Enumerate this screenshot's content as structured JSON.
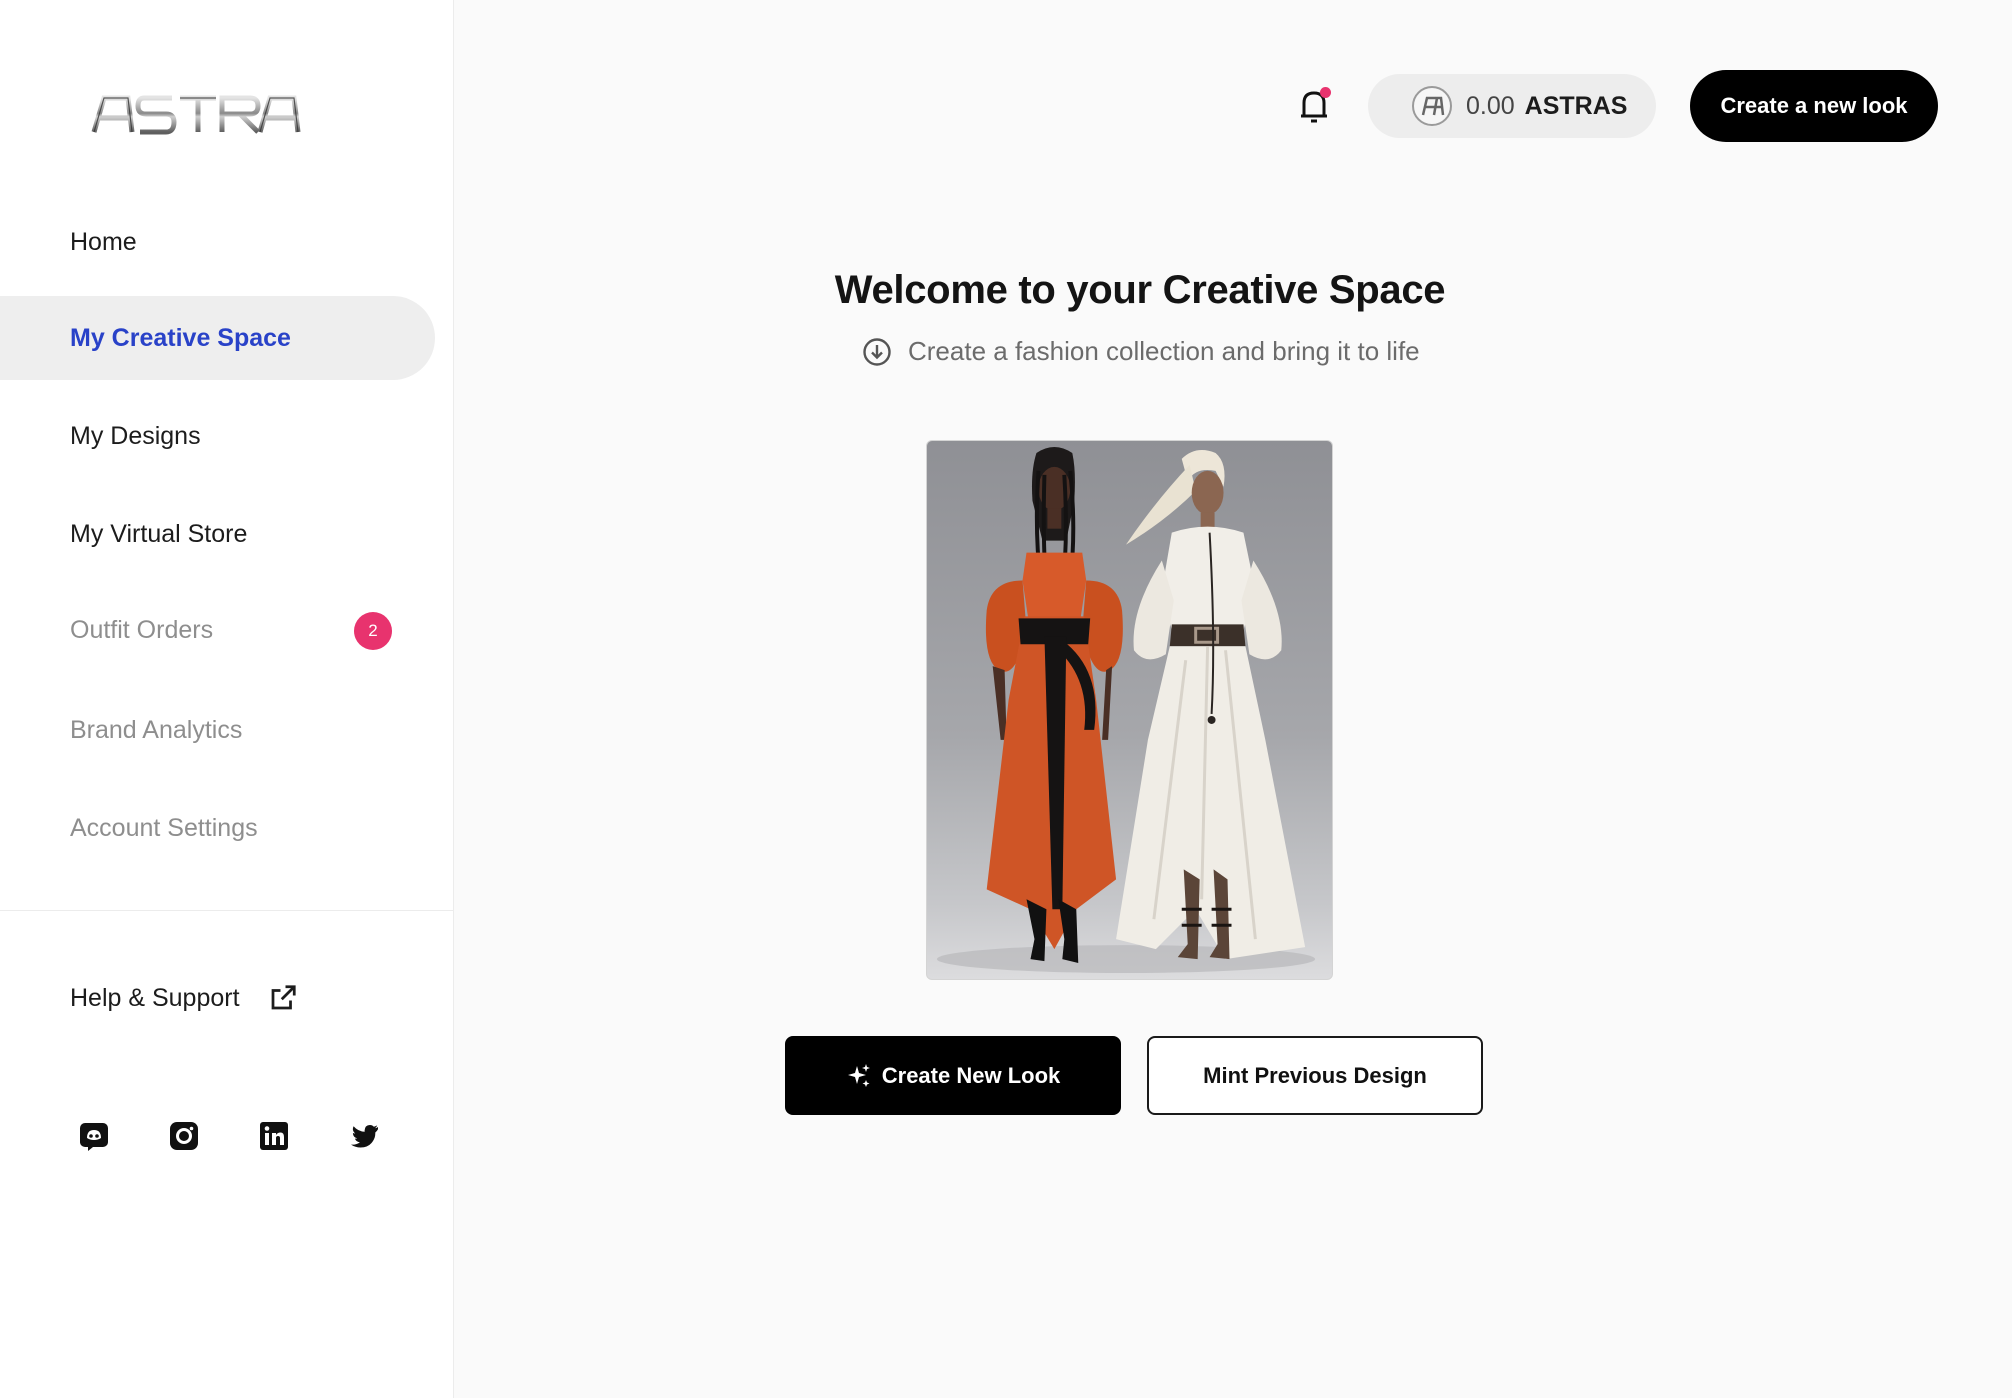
{
  "brand": {
    "logo_text": "ASTRA"
  },
  "sidebar": {
    "nav": [
      {
        "label": "Home"
      },
      {
        "label": "My Creative Space",
        "active": true
      },
      {
        "label": "My Designs"
      },
      {
        "label": "My Virtual Store"
      },
      {
        "label": "Outfit Orders",
        "badge": "2",
        "disabled": true
      },
      {
        "label": "Brand Analytics",
        "disabled": true
      },
      {
        "label": "Account Settings",
        "disabled": true
      }
    ],
    "help": {
      "label": "Help & Support",
      "icon": "external-link-icon"
    },
    "socials": [
      "discord-icon",
      "instagram-icon",
      "linkedin-icon",
      "twitter-icon"
    ]
  },
  "topbar": {
    "notification_icon": "bell-icon",
    "balance": {
      "amount": "0.00",
      "unit": "ASTRAS",
      "icon": "astra-coin-icon"
    },
    "cta_label": "Create a new look"
  },
  "main": {
    "title": "Welcome to your Creative Space",
    "subtitle": "Create a fashion collection and bring it to life",
    "subtitle_icon": "download-circle-icon",
    "primary_button": {
      "label": "Create New Look",
      "icon": "sparkle-icon"
    },
    "secondary_button": {
      "label": "Mint Previous Design"
    }
  },
  "colors": {
    "accent": "#2942c8",
    "badge": "#e8336e",
    "primary_button": "#000000",
    "background": "#fafafa"
  }
}
